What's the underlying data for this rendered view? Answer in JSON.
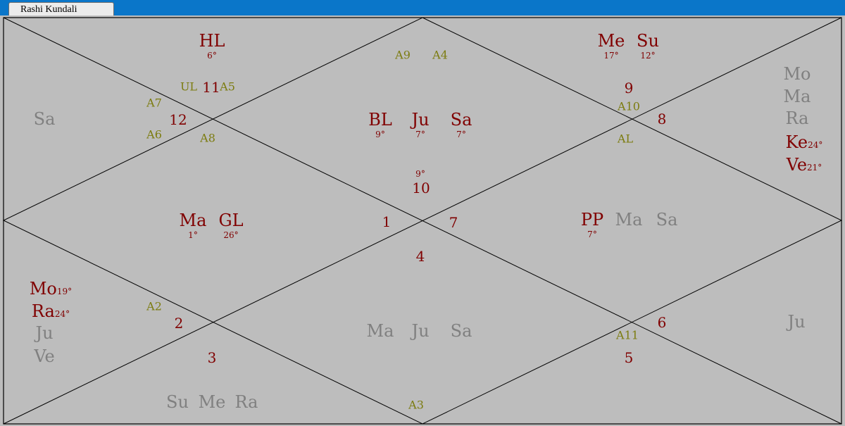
{
  "tab": {
    "label": "Rashi Kundali"
  },
  "colors": {
    "background": "#bdbdbd",
    "border": "#000000",
    "planet_active": "#800000",
    "planet_inactive": "#808080",
    "house_number": "#800000",
    "arudha": "#7c7c10",
    "titlebar": "#0a76c9"
  },
  "houses": [
    {
      "id": "h10",
      "value": "10"
    },
    {
      "id": "h11",
      "value": "11"
    },
    {
      "id": "h12",
      "value": "12"
    },
    {
      "id": "h1",
      "value": "1"
    },
    {
      "id": "h2",
      "value": "2"
    },
    {
      "id": "h3",
      "value": "3"
    },
    {
      "id": "h4",
      "value": "4"
    },
    {
      "id": "h5",
      "value": "5"
    },
    {
      "id": "h6",
      "value": "6"
    },
    {
      "id": "h7",
      "value": "7"
    },
    {
      "id": "h8",
      "value": "8"
    },
    {
      "id": "h9",
      "value": "9"
    }
  ],
  "arudhas": [
    {
      "id": "a9",
      "value": "A9"
    },
    {
      "id": "a4",
      "value": "A4"
    },
    {
      "id": "ul",
      "value": "UL"
    },
    {
      "id": "a5",
      "value": "A5"
    },
    {
      "id": "a7",
      "value": "A7"
    },
    {
      "id": "a6",
      "value": "A6"
    },
    {
      "id": "a8",
      "value": "A8"
    },
    {
      "id": "a10",
      "value": "A10"
    },
    {
      "id": "al",
      "value": "AL"
    },
    {
      "id": "a2",
      "value": "A2"
    },
    {
      "id": "a11",
      "value": "A11"
    },
    {
      "id": "a3",
      "value": "A3"
    }
  ],
  "planets": [
    {
      "id": "hl",
      "value": "HL",
      "degree": "6°",
      "active": true
    },
    {
      "id": "me_top",
      "value": "Me",
      "degree": "17°",
      "active": true
    },
    {
      "id": "su_top",
      "value": "Su",
      "degree": "12°",
      "active": true
    },
    {
      "id": "bl",
      "value": "BL",
      "degree": "9°",
      "active": true
    },
    {
      "id": "ju_c",
      "value": "Ju",
      "degree": "7°",
      "active": true
    },
    {
      "id": "sa_c",
      "value": "Sa",
      "degree": "7°",
      "active": true
    },
    {
      "id": "ma_l",
      "value": "Ma",
      "degree": "1°",
      "active": true
    },
    {
      "id": "gl",
      "value": "GL",
      "degree": "26°",
      "active": true
    },
    {
      "id": "pp",
      "value": "PP",
      "degree": "7°",
      "active": true
    },
    {
      "id": "ma_r",
      "value": "Ma",
      "degree": "",
      "active": false
    },
    {
      "id": "sa_r",
      "value": "Sa",
      "degree": "",
      "active": false
    },
    {
      "id": "sa_l",
      "value": "Sa",
      "degree": "",
      "active": false
    },
    {
      "id": "mo_r",
      "value": "Mo",
      "degree": "",
      "active": false
    },
    {
      "id": "ma_r2",
      "value": "Ma",
      "degree": "",
      "active": false
    },
    {
      "id": "ra_r",
      "value": "Ra",
      "degree": "",
      "active": false
    },
    {
      "id": "ju_lo",
      "value": "Ju",
      "degree": "",
      "active": false
    },
    {
      "id": "ve_lo",
      "value": "Ve",
      "degree": "",
      "active": false
    },
    {
      "id": "ma_b",
      "value": "Ma",
      "degree": "",
      "active": false
    },
    {
      "id": "ju_b",
      "value": "Ju",
      "degree": "",
      "active": false
    },
    {
      "id": "sa_b",
      "value": "Sa",
      "degree": "",
      "active": false
    },
    {
      "id": "su_bot",
      "value": "Su",
      "degree": "",
      "active": false
    },
    {
      "id": "me_bot",
      "value": "Me",
      "degree": "",
      "active": false
    },
    {
      "id": "ra_bot",
      "value": "Ra",
      "degree": "",
      "active": false
    },
    {
      "id": "ju_rr",
      "value": "Ju",
      "degree": "",
      "active": false
    }
  ],
  "subscript_planets": [
    {
      "id": "ke",
      "value": "Ke",
      "degree": "24°"
    },
    {
      "id": "ve",
      "value": "Ve",
      "degree": "21°"
    },
    {
      "id": "mo",
      "value": "Mo",
      "degree": "19°"
    },
    {
      "id": "ra",
      "value": "Ra",
      "degree": "24°"
    }
  ],
  "center_degree": {
    "id": "center_deg",
    "value": "9°"
  }
}
